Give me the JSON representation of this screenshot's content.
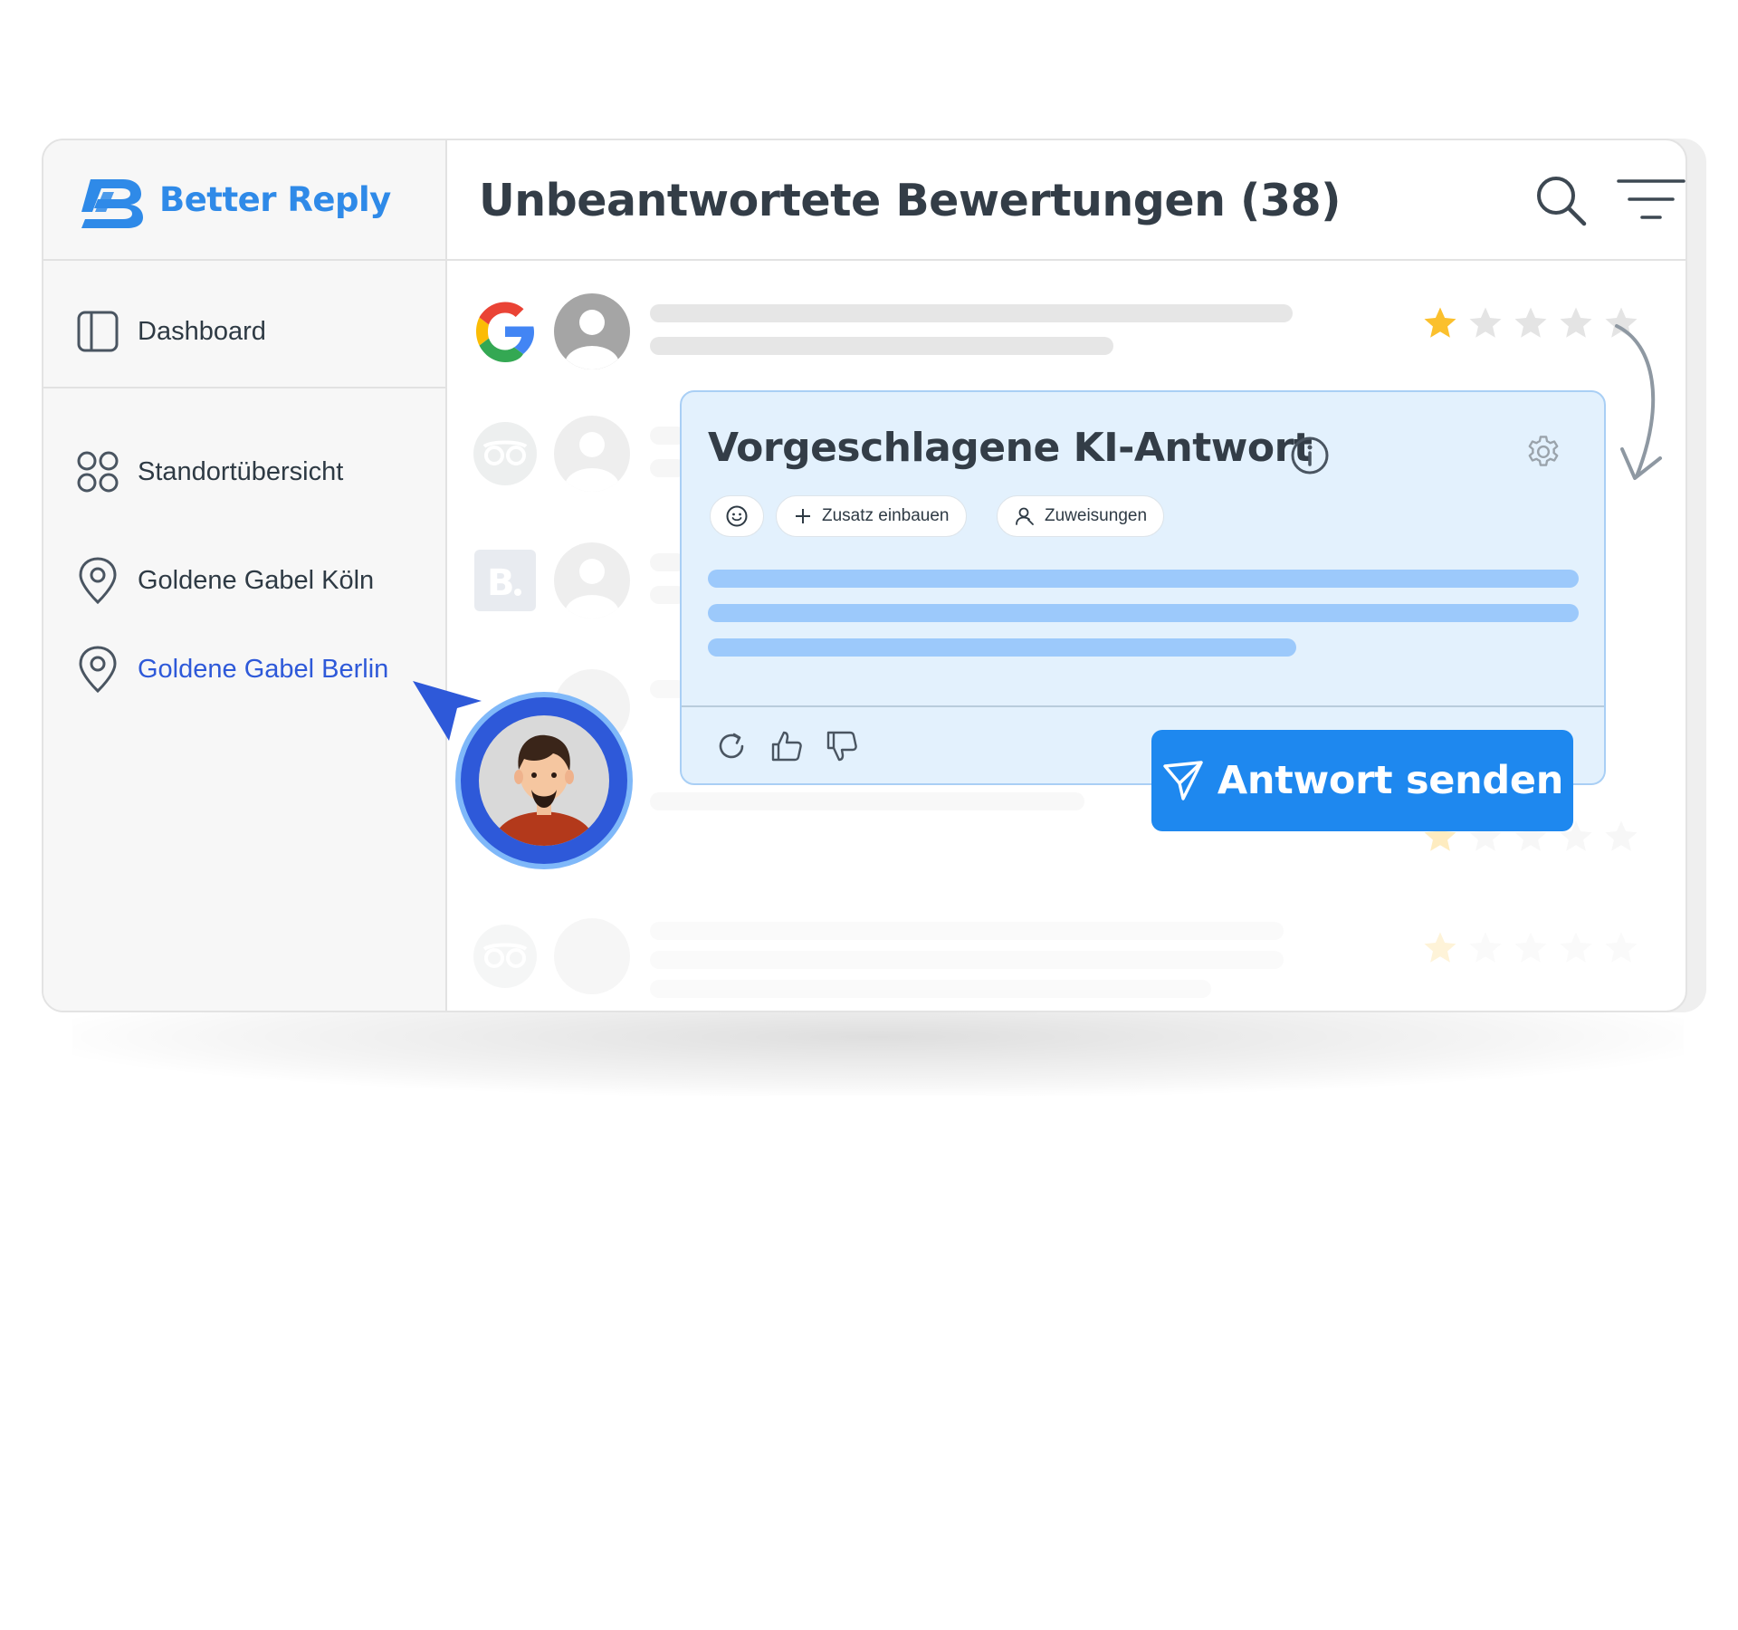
{
  "brand": {
    "name": "Better Reply",
    "color": "#2f8ae8"
  },
  "sidebar": {
    "items": [
      {
        "label": "Dashboard",
        "icon": "layout-panel-icon"
      },
      {
        "label": "Standortübersicht",
        "icon": "grid-circles-icon"
      },
      {
        "label": "Goldene Gabel Köln",
        "icon": "map-pin-icon"
      },
      {
        "label": "Goldene Gabel Berlin",
        "icon": "map-pin-icon",
        "active": true
      }
    ]
  },
  "header": {
    "title": "Unbeantwortete Bewertungen (38)",
    "icons": [
      "search-icon",
      "filter-icon"
    ]
  },
  "reviews": [
    {
      "source": "google",
      "rating": 1,
      "max_rating": 5
    },
    {
      "source": "tripadvisor"
    },
    {
      "source": "booking"
    },
    {
      "source": "unknown"
    },
    {
      "source": "tripadvisor",
      "rating": 1,
      "max_rating": 5
    }
  ],
  "ki_card": {
    "title": "Vorgeschlagene KI-Antwort",
    "chips": {
      "emoji": "emoji-icon",
      "add_label": "Zusatz einbauen",
      "assign_label": "Zuweisungen"
    },
    "footer_icons": [
      "refresh-icon",
      "thumbs-up-icon",
      "thumbs-down-icon"
    ]
  },
  "send_button": {
    "label": "Antwort senden",
    "color": "#1e88ef"
  },
  "colors": {
    "active_nav": "#2e59d9",
    "star": "#fbc02d",
    "card_bg": "#e3f1fd"
  }
}
